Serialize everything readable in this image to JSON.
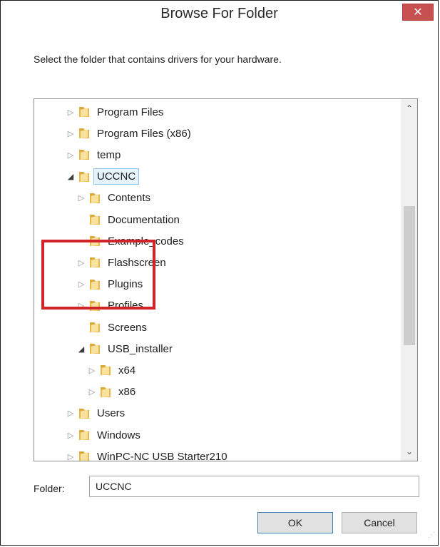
{
  "window": {
    "title": "Browse For Folder",
    "close_icon": "close-icon",
    "prompt": "Select the folder that contains drivers for your hardware."
  },
  "tree": {
    "items": [
      {
        "label": "Program Files",
        "level": 0,
        "expander": "collapsed"
      },
      {
        "label": "Program Files (x86)",
        "level": 0,
        "expander": "collapsed"
      },
      {
        "label": "temp",
        "level": 0,
        "expander": "collapsed"
      },
      {
        "label": "UCCNC",
        "level": 0,
        "expander": "expanded",
        "selected": true
      },
      {
        "label": "Contents",
        "level": 1,
        "expander": "collapsed"
      },
      {
        "label": "Documentation",
        "level": 1,
        "expander": "none"
      },
      {
        "label": "Example_codes",
        "level": 1,
        "expander": "none"
      },
      {
        "label": "Flashscreen",
        "level": 1,
        "expander": "collapsed"
      },
      {
        "label": "Plugins",
        "level": 1,
        "expander": "collapsed"
      },
      {
        "label": "Profiles",
        "level": 1,
        "expander": "collapsed"
      },
      {
        "label": "Screens",
        "level": 1,
        "expander": "none"
      },
      {
        "label": "USB_installer",
        "level": 1,
        "expander": "expanded-filled"
      },
      {
        "label": "x64",
        "level": 2,
        "expander": "collapsed"
      },
      {
        "label": "x86",
        "level": 2,
        "expander": "collapsed"
      },
      {
        "label": "Users",
        "level": 0,
        "expander": "collapsed"
      },
      {
        "label": "Windows",
        "level": 0,
        "expander": "collapsed"
      },
      {
        "label": "WinPC-NC USB Starter210",
        "level": 0,
        "expander": "collapsed"
      }
    ],
    "scroll_position": 0.45
  },
  "highlight_color": "#d2232a",
  "folder": {
    "label": "Folder:",
    "value": "UCCNC"
  },
  "buttons": {
    "ok": "OK",
    "cancel": "Cancel"
  },
  "colors": {
    "close_button": "#c75050",
    "selection": "#e5f3fb",
    "folder": "#e8b84a"
  }
}
